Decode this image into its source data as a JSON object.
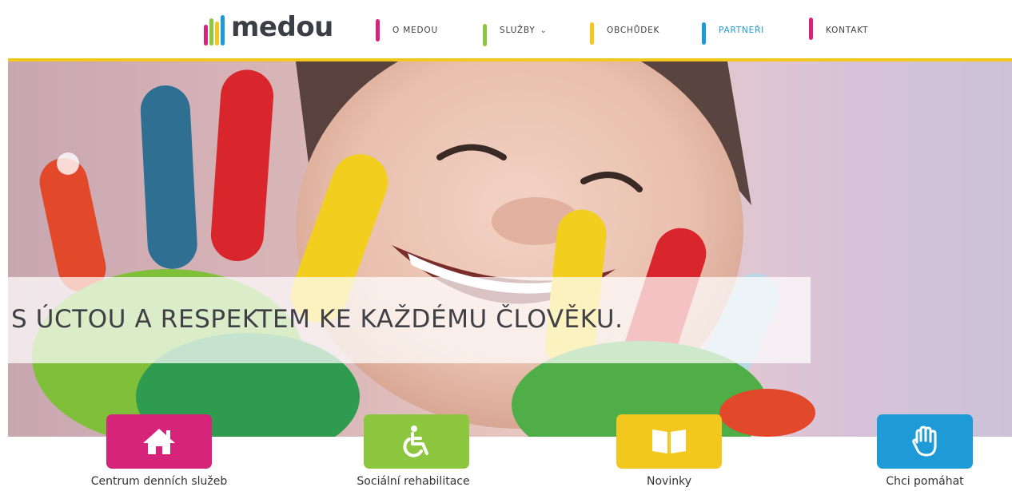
{
  "header": {
    "logo_text": "medou",
    "nav": [
      {
        "label": "O MEDOU",
        "color": "#d6247a",
        "dropdown": false,
        "active": false
      },
      {
        "label": "SLUŽBY",
        "color": "#8dc63f",
        "dropdown": true,
        "active": false
      },
      {
        "label": "OBCHŮDEK",
        "color": "#f2c81f",
        "dropdown": false,
        "active": false
      },
      {
        "label": "PARTNEŘI",
        "color": "#1e9ad6",
        "dropdown": false,
        "active": true
      },
      {
        "label": "KONTAKT",
        "color": "#d6247a",
        "dropdown": false,
        "active": false
      }
    ]
  },
  "hero": {
    "tagline": "S ÚCTOU A RESPEKTEM KE KAŽDÉMU ČLOVĚKU."
  },
  "tiles": [
    {
      "label": "Centrum denních služeb",
      "icon": "house-icon",
      "color": "#d6247a"
    },
    {
      "label": "Sociální rehabilitace",
      "icon": "wheelchair-icon",
      "color": "#8dc63f"
    },
    {
      "label": "Novinky",
      "icon": "book-icon",
      "color": "#f2c81f"
    },
    {
      "label": "Chci pomáhat",
      "icon": "hand-icon",
      "color": "#1e9ad6"
    }
  ],
  "colors": {
    "accent_yellow": "#f2c81f",
    "brand_pink": "#d6247a",
    "brand_green": "#8dc63f",
    "brand_blue": "#1e9ad6",
    "text_dark": "#3f3f46"
  }
}
